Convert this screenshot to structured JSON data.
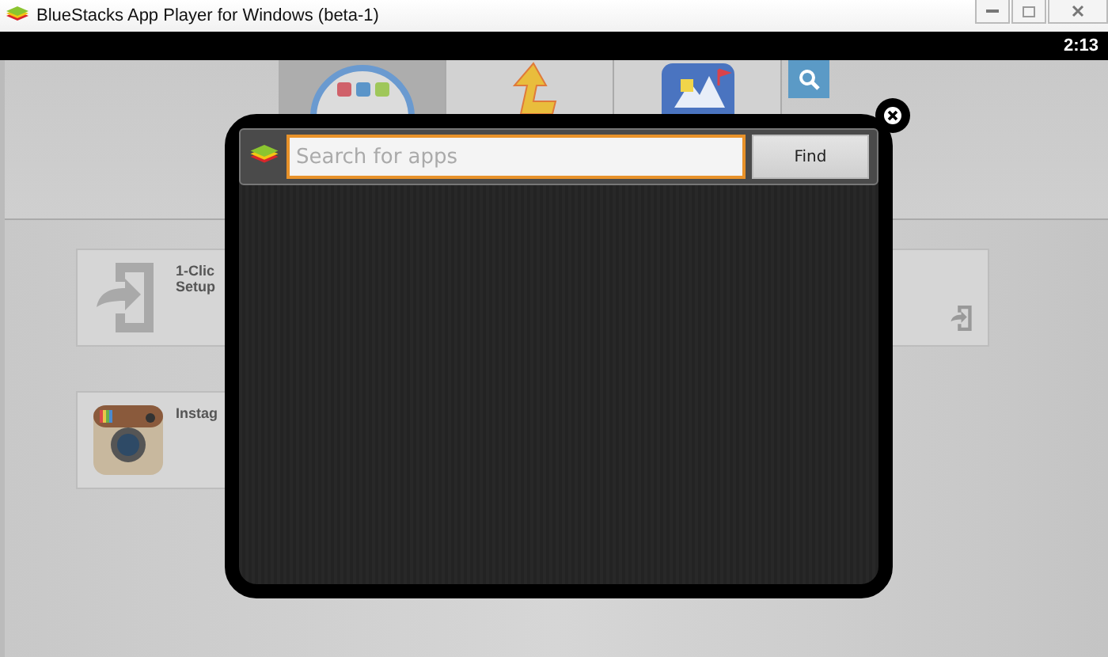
{
  "window": {
    "title": "BlueStacks App Player for Windows (beta-1)"
  },
  "status_bar": {
    "time": "2:13"
  },
  "tabs": [
    {
      "kind": "apps",
      "selected": true
    },
    {
      "kind": "arrow",
      "selected": false
    },
    {
      "kind": "gallery",
      "selected": false
    },
    {
      "kind": "search",
      "selected": false
    }
  ],
  "cards": [
    {
      "kind": "setup",
      "lines": [
        "1-Clic",
        "Setup"
      ]
    },
    {
      "kind": "instagram",
      "lines": [
        "Instag"
      ]
    },
    {
      "kind": "compact"
    }
  ],
  "dialog": {
    "search": {
      "placeholder": "Search for apps",
      "focused": true
    },
    "button": "Find"
  }
}
